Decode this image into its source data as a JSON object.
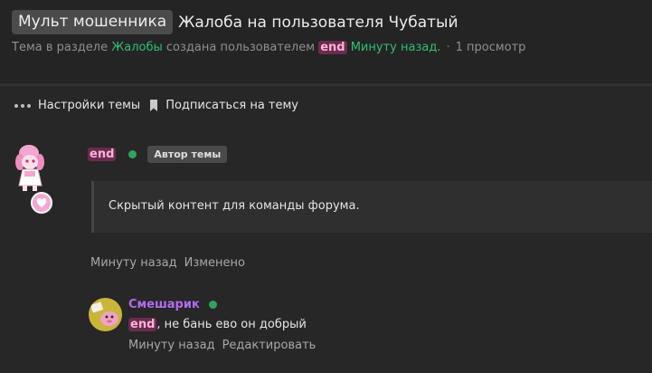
{
  "thread": {
    "prefix": "Мульт мошенника",
    "title": "Жалоба на пользователя Чубатый",
    "meta_prefix": "Тема в разделе",
    "section": "Жалобы",
    "created_by": "создана пользователем",
    "author": "end",
    "time": "Минуту назад.",
    "views": "1 просмотр"
  },
  "toolbar": {
    "settings_label": "Настройки темы",
    "subscribe_label": "Подписаться на тему"
  },
  "post": {
    "author": "end",
    "badge": "Автор темы",
    "hidden_content": "Скрытый контент для команды форума.",
    "time": "Минуту назад",
    "edited": "Изменено"
  },
  "comment": {
    "author": "Смешарик",
    "mention": "end",
    "text": ", не бань ево он добрый",
    "time": "Минуту назад",
    "edit_label": "Редактировать"
  },
  "colors": {
    "background": "#272727",
    "accent_green": "#2fbf71",
    "nick_highlight": "#6a2c4e",
    "comment_name": "#b16cf0"
  }
}
